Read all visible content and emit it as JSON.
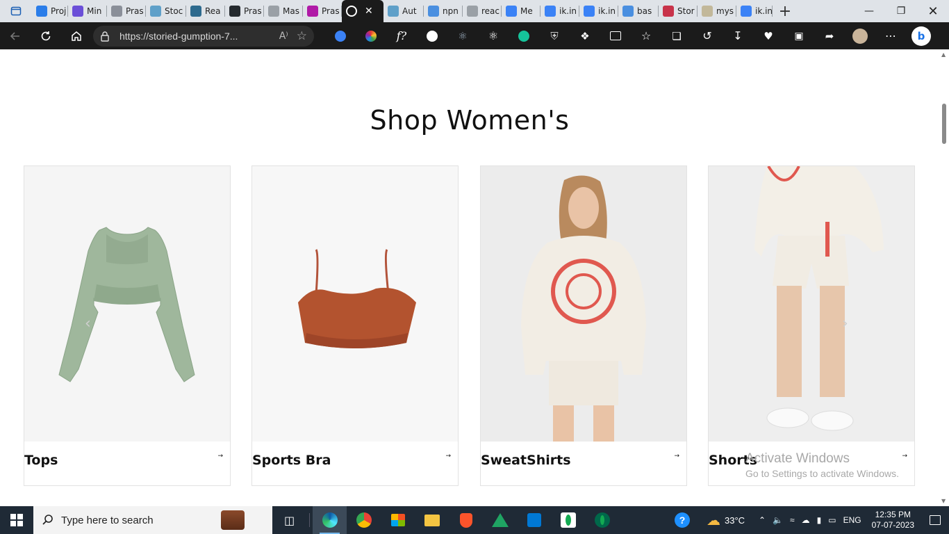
{
  "browser": {
    "tabs": [
      {
        "label": "Proj",
        "color": "#2b7de9"
      },
      {
        "label": "Min",
        "color": "#6b4fd8"
      },
      {
        "label": "Pras",
        "color": "#8a8f99"
      },
      {
        "label": "Stoc",
        "color": "#5fa0c9"
      },
      {
        "label": "Rea",
        "color": "#2d6a8e"
      },
      {
        "label": "Pras",
        "color": "#24292e"
      },
      {
        "label": "Mas",
        "color": "#9aa0a6"
      },
      {
        "label": "Pras",
        "color": "#b01aa7"
      },
      {
        "label": "",
        "color": "#ffffff",
        "active": true
      },
      {
        "label": "Aut",
        "color": "#5fa0c9"
      },
      {
        "label": "npn",
        "color": "#4a8fe0"
      },
      {
        "label": "reac",
        "color": "#9aa0a6"
      },
      {
        "label": "Me",
        "color": "#3b82f6"
      },
      {
        "label": "ik.in",
        "color": "#3b82f6"
      },
      {
        "label": "ik.in",
        "color": "#3b82f6"
      },
      {
        "label": "bas",
        "color": "#4a8fe0"
      },
      {
        "label": "Stor",
        "color": "#c8334a"
      },
      {
        "label": "mys",
        "color": "#c2b89a"
      },
      {
        "label": "ik.in",
        "color": "#3b82f6"
      }
    ],
    "url": "https://storied-gumption-7...",
    "read_aloud": "A⁾"
  },
  "page": {
    "title": "Shop Women's",
    "categories": [
      {
        "label": "Tops",
        "arrow": "→",
        "image": "green-cropped-top"
      },
      {
        "label": "Sports Bra",
        "arrow": "→",
        "image": "rust-sports-bra"
      },
      {
        "label": "SweatShirts",
        "arrow": "→",
        "image": "cream-hoodie-model"
      },
      {
        "label": "Shorts",
        "arrow": "→",
        "image": "cream-shorts-model"
      }
    ],
    "prev_icon": "chevron-left-icon",
    "next_icon": "chevron-right-icon"
  },
  "watermark": {
    "line1": "Activate Windows",
    "line2": "Go to Settings to activate Windows."
  },
  "taskbar": {
    "search_placeholder": "Type here to search",
    "weather": "33°C",
    "language": "ENG",
    "time": "12:35 PM",
    "date": "07-07-2023"
  }
}
